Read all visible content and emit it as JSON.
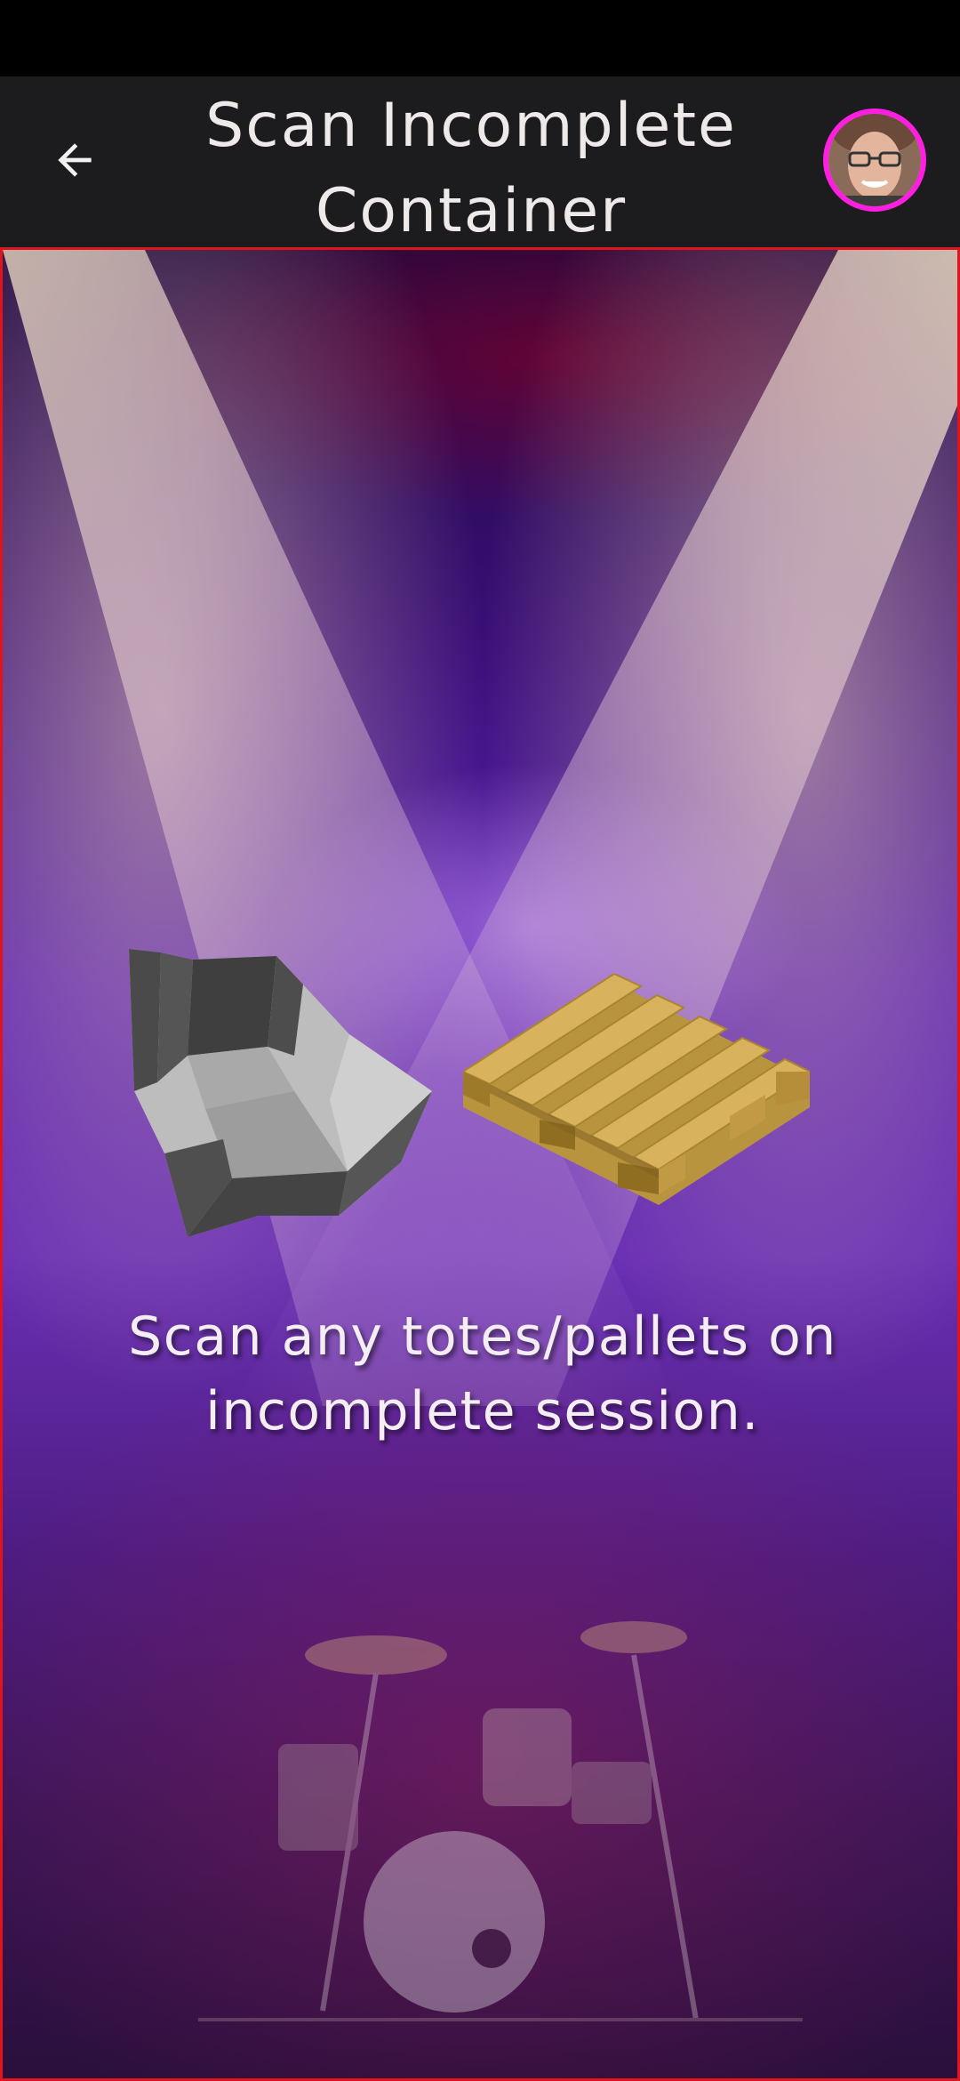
{
  "header": {
    "title": "Scan Incomplete Container",
    "back_icon": "arrow-left-icon",
    "avatar_icon": "user-avatar"
  },
  "main": {
    "instruction": "Scan any totes/pallets on incomplete session.",
    "tote_icon": "tote-bin-icon",
    "pallet_icon": "wooden-pallet-icon"
  },
  "colors": {
    "header_bg": "#1c1b1e",
    "avatar_ring": "#ff1fe0",
    "stage_border": "#e0141b",
    "text": "#eeeaea"
  }
}
